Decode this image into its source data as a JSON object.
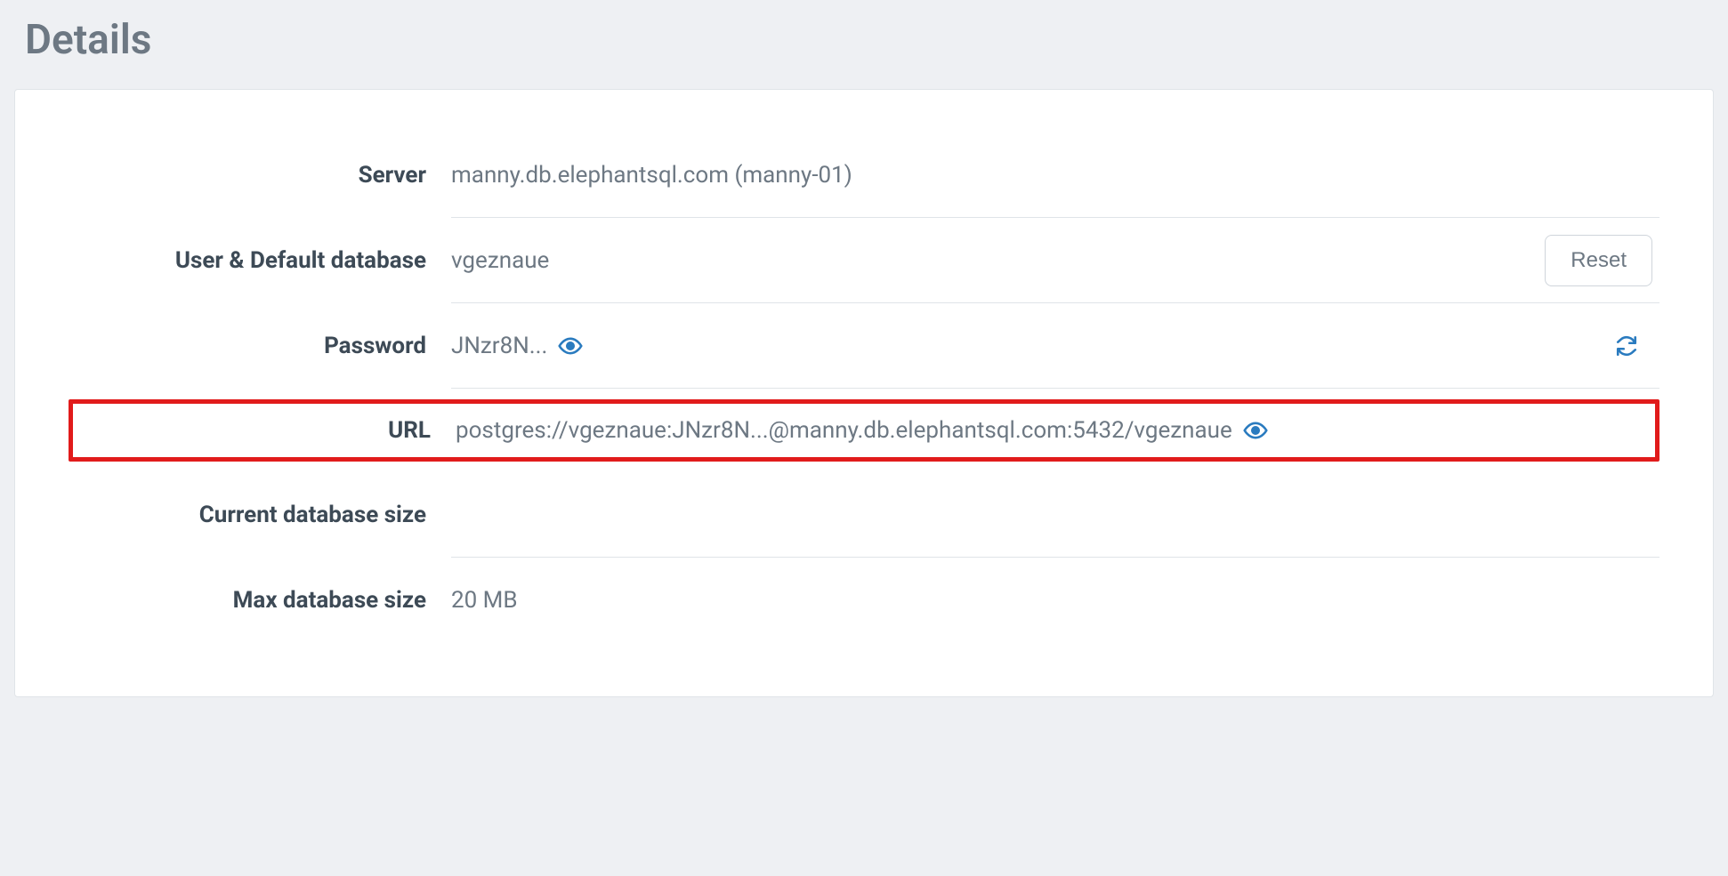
{
  "page": {
    "title": "Details"
  },
  "details": {
    "server": {
      "label": "Server",
      "value": "manny.db.elephantsql.com (manny-01)"
    },
    "user_db": {
      "label": "User & Default database",
      "value": "vgeznaue",
      "reset_button": "Reset"
    },
    "password": {
      "label": "Password",
      "value": "JNzr8N..."
    },
    "url": {
      "label": "URL",
      "value": "postgres://vgeznaue:JNzr8N...@manny.db.elephantsql.com:5432/vgeznaue"
    },
    "current_size": {
      "label": "Current database size",
      "value": ""
    },
    "max_size": {
      "label": "Max database size",
      "value": "20 MB"
    }
  }
}
